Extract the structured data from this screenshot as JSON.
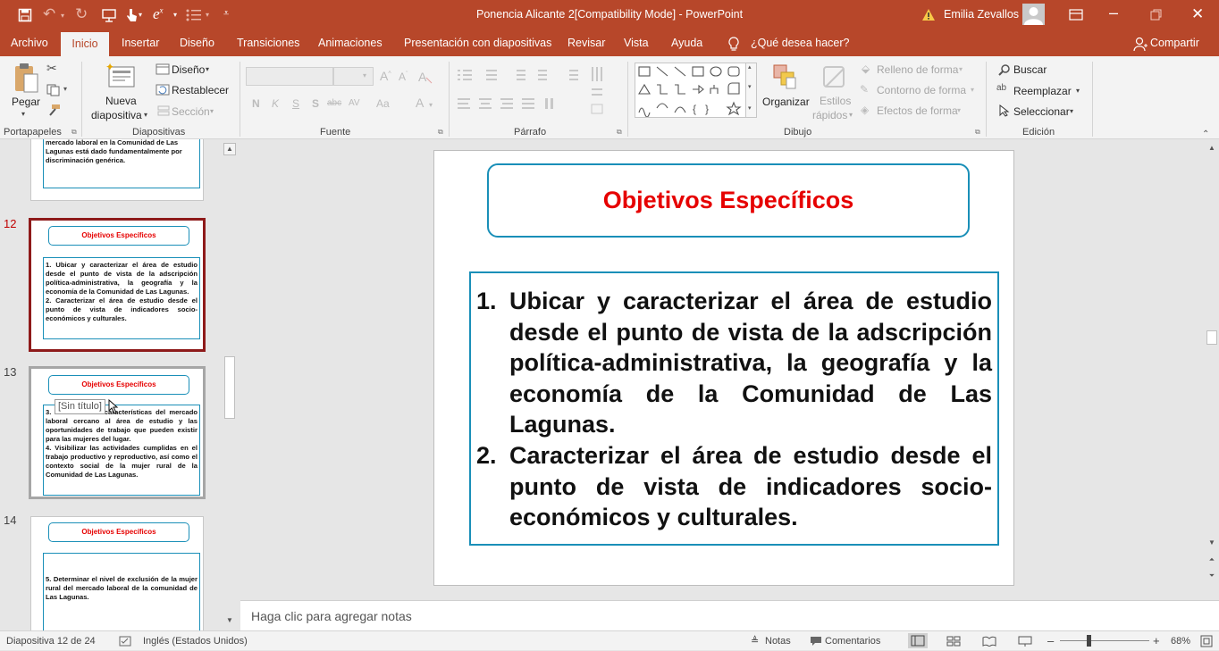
{
  "titlebar": {
    "document_title": "Ponencia Alicante 2[Compatibility Mode]  -  PowerPoint",
    "user_name": "Emilia Zevallos",
    "warning_icon": "warning-icon",
    "qat_icons": [
      "save-icon",
      "undo-icon",
      "redo-icon",
      "start-from-beginning-icon",
      "touch-mode-icon",
      "equation-icon",
      "bullets-icon",
      "customize-qat-icon"
    ],
    "colors": {
      "accent": "#b7472a",
      "accent_text": "#ffffff"
    }
  },
  "tabs": {
    "items": [
      "Archivo",
      "Inicio",
      "Insertar",
      "Diseño",
      "Transiciones",
      "Animaciones",
      "Presentación con diapositivas",
      "Revisar",
      "Vista",
      "Ayuda"
    ],
    "tell_me": "¿Qué desea hacer?",
    "share": "Compartir",
    "active": "Inicio"
  },
  "ribbon": {
    "portapapeles": {
      "label": "Portapapeles",
      "paste": "Pegar"
    },
    "diapositivas": {
      "label": "Diapositivas",
      "new_slide_1": "Nueva",
      "new_slide_2": "diapositiva",
      "layout": "Diseño",
      "reset": "Restablecer",
      "section": "Sección"
    },
    "fuente": {
      "label": "Fuente",
      "bold": "N",
      "italic": "K",
      "underline": "S",
      "shadow": "S",
      "strike": "abc",
      "case": "Aa"
    },
    "parrafo": {
      "label": "Párrafo"
    },
    "dibujo": {
      "label": "Dibujo",
      "arrange": "Organizar",
      "quick_styles_1": "Estilos",
      "quick_styles_2": "rápidos",
      "fill": "Relleno de forma",
      "outline": "Contorno de forma",
      "effects": "Efectos de forma"
    },
    "edicion": {
      "label": "Edición",
      "find": "Buscar",
      "replace": "Reemplazar",
      "select": "Seleccionar"
    }
  },
  "thumbnails": {
    "prev_text": "mercado laboral en la Comunidad de Las Lagunas está dado fundamentalmente por discriminación genérica.",
    "slides": [
      {
        "number": "12",
        "title": "Objetivos Específicos",
        "body": "1. Ubicar y caracterizar el área de estudio desde el punto de vista de la adscripción política-administrativa, la geografía y la economía de la Comunidad de Las Lagunas.\n2. Caracterizar el área de estudio desde el punto de vista de indicadores socio-económicos y culturales."
      },
      {
        "number": "13",
        "title": "Objetivos Específicos",
        "body": "3. Identificar las características del mercado laboral cercano al área de estudio y las oportunidades de trabajo que pueden existir para las mujeres del lugar.\n4. Visibilizar las actividades cumplidas en el trabajo productivo y reproductivo, así como el contexto social de la mujer rural de la Comunidad de Las Lagunas.",
        "tooltip": "[Sin título]"
      },
      {
        "number": "14",
        "title": "Objetivos Específicos",
        "body": "5. Determinar el nivel de exclusión de la mujer rural del mercado laboral de la comunidad de Las Lagunas."
      }
    ]
  },
  "slide": {
    "title": "Objetivos Específicos",
    "items": [
      {
        "num": "1.",
        "text": "Ubicar y caracterizar el área de estudio desde el punto de vista de la adscripción política-administrativa, la geografía y la economía de la Comunidad de Las Lagunas."
      },
      {
        "num": "2.",
        "text": "Caracterizar el área de estudio desde el punto de vista de indicadores socio-económicos y culturales."
      }
    ],
    "colors": {
      "title": "#e60000",
      "border": "#1a8fb8"
    }
  },
  "notes": {
    "placeholder": "Haga clic para agregar notas"
  },
  "status": {
    "slide_counter": "Diapositiva 12 de 24",
    "language": "Inglés (Estados Unidos)",
    "notes": "Notas",
    "comments": "Comentarios",
    "zoom": "68%",
    "zoom_level": 0.68
  }
}
